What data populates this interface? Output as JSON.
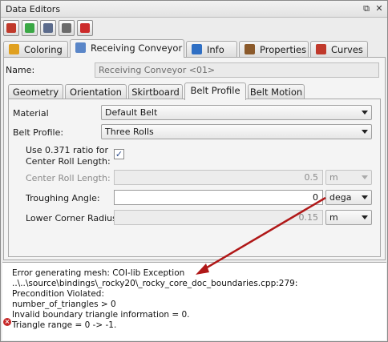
{
  "window": {
    "title": "Data Editors",
    "restore_glyph": "⧉",
    "close_glyph": "✕"
  },
  "toolbar": {
    "buttons": [
      {
        "icon": "grid-icon",
        "color": "#c0392b"
      },
      {
        "icon": "cube-icon",
        "color": "#3aa845"
      },
      {
        "icon": "copy-icon",
        "color": "#5b6b8c"
      },
      {
        "icon": "paste-icon",
        "color": "#6b6b6b"
      },
      {
        "icon": "delete-icon",
        "color": "#cc2a2a"
      }
    ]
  },
  "main_tabs": [
    {
      "label": "Coloring",
      "icon": "palette-icon",
      "color": "#e0a020"
    },
    {
      "label": "Receiving Conveyor",
      "icon": "conveyor-icon",
      "color": "#5a86c8"
    },
    {
      "label": "Info",
      "icon": "info-icon",
      "color": "#2f6fc4"
    },
    {
      "label": "Properties",
      "icon": "properties-icon",
      "color": "#8b5a2b"
    },
    {
      "label": "Curves",
      "icon": "curves-icon",
      "color": "#c0392b"
    }
  ],
  "name": {
    "label": "Name:",
    "value": "Receiving Conveyor <01>"
  },
  "sub_tabs": [
    "Geometry",
    "Orientation",
    "Skirtboard",
    "Belt Profile",
    "Belt Motion"
  ],
  "fields": {
    "material": {
      "label": "Material",
      "value": "Default Belt"
    },
    "belt_profile": {
      "label": "Belt Profile:",
      "value": "Three Rolls"
    },
    "ratio": {
      "label_line1": "Use 0.371 ratio for",
      "label_line2": "Center Roll Length:",
      "checked": true,
      "check_glyph": "✓"
    },
    "center_roll_length": {
      "label": "Center Roll Length:",
      "value": "0.5",
      "unit": "m"
    },
    "troughing_angle": {
      "label": "Troughing Angle:",
      "value": "0",
      "unit": "dega"
    },
    "lower_corner_radius": {
      "label": "Lower Corner Radius:",
      "value": "0.15",
      "unit": "m"
    }
  },
  "messages": {
    "error_icon": "error-icon",
    "error_glyph": "×",
    "lines": [
      "Error generating mesh: COI-lib Exception",
      "..\\..\\source\\bindings\\_rocky20\\_rocky_core_doc_boundaries.cpp:279:",
      "Precondition Violated:",
      "number_of_triangles > 0",
      "Invalid boundary triangle information = 0.",
      "Triangle range = 0 -> -1."
    ]
  },
  "colors": {
    "annotation_arrow": "#b01818",
    "error": "#c62828"
  }
}
